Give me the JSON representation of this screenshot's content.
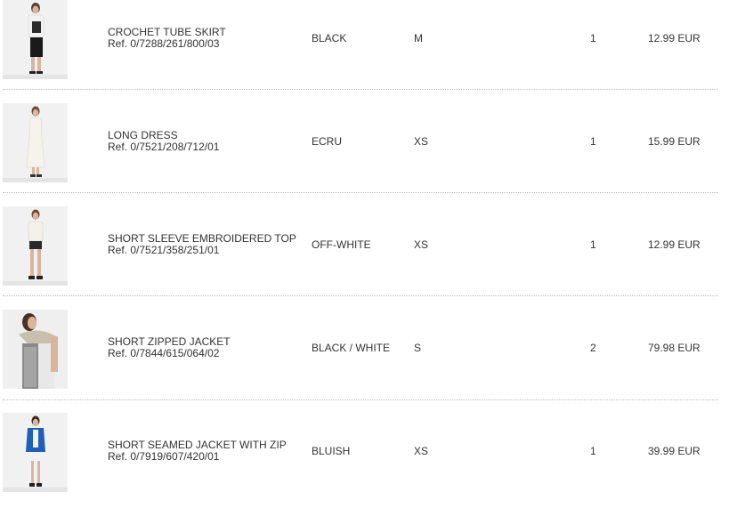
{
  "order_items": [
    {
      "name": "CROCHET TUBE SKIRT",
      "ref": "Ref. 0/7288/261/800/03",
      "color": "BLACK",
      "size": "M",
      "quantity": "1",
      "price": "12.99 EUR",
      "thumbnail": {
        "top": "#f2f2f2",
        "bottom": "#1a1a1a",
        "skin": "#d9b59e",
        "hair": "#5a4030"
      }
    },
    {
      "name": "LONG DRESS",
      "ref": "Ref. 0/7521/208/712/01",
      "color": "ECRU",
      "size": "XS",
      "quantity": "1",
      "price": "15.99 EUR",
      "thumbnail": {
        "top": "#f6f3ec",
        "bottom": "#f6f3ec",
        "skin": "#d9b59e",
        "hair": "#6b4a35"
      }
    },
    {
      "name": "SHORT SLEEVE EMBROIDERED TOP",
      "ref": "Ref. 0/7521/358/251/01",
      "color": "OFF-WHITE",
      "size": "XS",
      "quantity": "1",
      "price": "12.99 EUR",
      "thumbnail": {
        "top": "#f4f1ea",
        "bottom": "#2a2a2a",
        "skin": "#d9b59e",
        "hair": "#6b4a35"
      }
    },
    {
      "name": "SHORT ZIPPED JACKET",
      "ref": "Ref. 0/7844/615/064/02",
      "color": "BLACK / WHITE",
      "size": "S",
      "quantity": "2",
      "price": "79.98 EUR",
      "thumbnail": {
        "top": "#9a9a9a",
        "bottom": "#e8e8e8",
        "skin": "#d9b59e",
        "hair": "#4a3326"
      }
    },
    {
      "name": "SHORT SEAMED JACKET WITH ZIP",
      "ref": "Ref. 0/7919/607/420/01",
      "color": "BLUISH",
      "size": "XS",
      "quantity": "1",
      "price": "39.99 EUR",
      "thumbnail": {
        "top": "#1f5fb5",
        "bottom": "#f2f2f2",
        "skin": "#d9b59e",
        "hair": "#3a2a20"
      }
    }
  ]
}
